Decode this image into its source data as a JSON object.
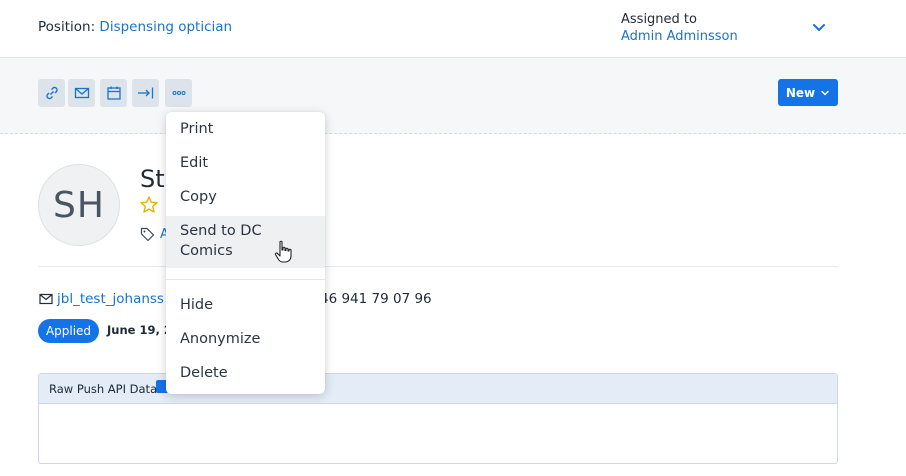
{
  "header": {
    "position_label": "Position:",
    "position_value": "Dispensing optician",
    "assigned_label": "Assigned to",
    "assigned_value": "Admin Adminsson"
  },
  "toolbar": {
    "buttons": [
      "link-icon",
      "mail-icon",
      "calendar-icon",
      "move-icon",
      "more-icon"
    ],
    "new_label": "New"
  },
  "candidate": {
    "initials": "SH",
    "name_visible": "St",
    "tag_visible": "A",
    "email_visible": "jbl_test_johanss",
    "phone_visible": "46 941 79 07 96",
    "status_badge": "Applied",
    "date_visible": "June 19, 2"
  },
  "panel": {
    "title": "Raw Push API Data"
  },
  "context_menu": {
    "items": [
      "Print",
      "Edit",
      "Copy",
      "Send to DC Comics",
      "Hide",
      "Anonymize",
      "Delete"
    ],
    "send_line1": "Send to DC",
    "send_line2": "Comics"
  },
  "colors": {
    "accent": "#1473e6",
    "link": "#1a73c8",
    "toolbar_bg": "#f6f7f9",
    "panel_head": "#e3ecf7"
  }
}
